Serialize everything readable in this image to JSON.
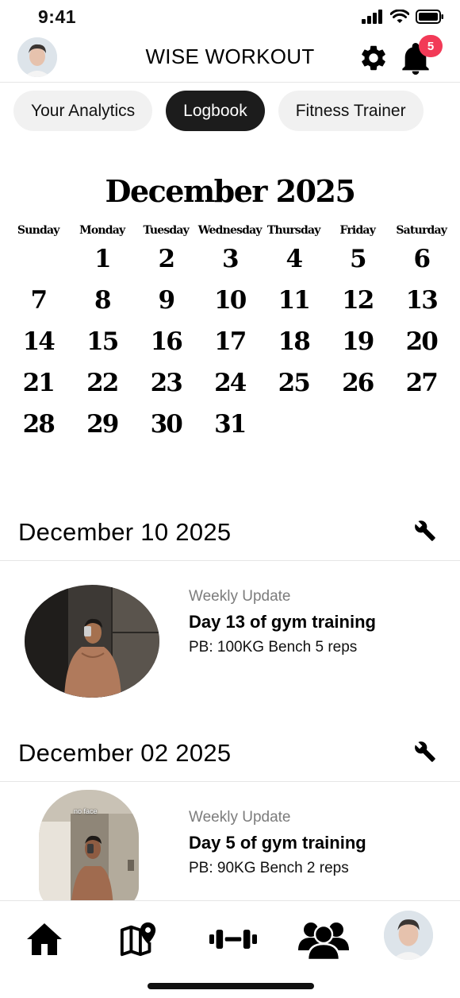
{
  "status_bar": {
    "time": "9:41"
  },
  "header": {
    "title": "WISE WORKOUT",
    "notification_count": "5"
  },
  "tabs": [
    {
      "label": "Your Analytics",
      "active": false
    },
    {
      "label": "Logbook",
      "active": true
    },
    {
      "label": "Fitness Trainer",
      "active": false
    }
  ],
  "calendar": {
    "title": "December 2025",
    "weekdays": [
      "Sunday",
      "Monday",
      "Tuesday",
      "Wednesday",
      "Thursday",
      "Friday",
      "Saturday"
    ],
    "first_weekday_index": 1,
    "days_in_month": 31
  },
  "entries": [
    {
      "date": "December 10 2025",
      "subtitle": "Weekly Update",
      "title": "Day 13 of gym training",
      "pb": "PB: 100KG Bench 5 reps"
    },
    {
      "date": "December 02 2025",
      "subtitle": "Weekly Update",
      "title": "Day 5 of gym training",
      "pb": "PB: 90KG Bench 2 reps",
      "photo_caption": "no face"
    }
  ],
  "bottom_nav": [
    {
      "name": "home",
      "icon": "home-icon"
    },
    {
      "name": "map",
      "icon": "map-pin-icon"
    },
    {
      "name": "workouts",
      "icon": "dumbbell-icon"
    },
    {
      "name": "community",
      "icon": "users-icon"
    },
    {
      "name": "profile",
      "icon": "avatar"
    }
  ],
  "colors": {
    "badge": "#f23a57",
    "active_tab": "#1c1c1c",
    "inactive_tab": "#f1f1f1"
  }
}
